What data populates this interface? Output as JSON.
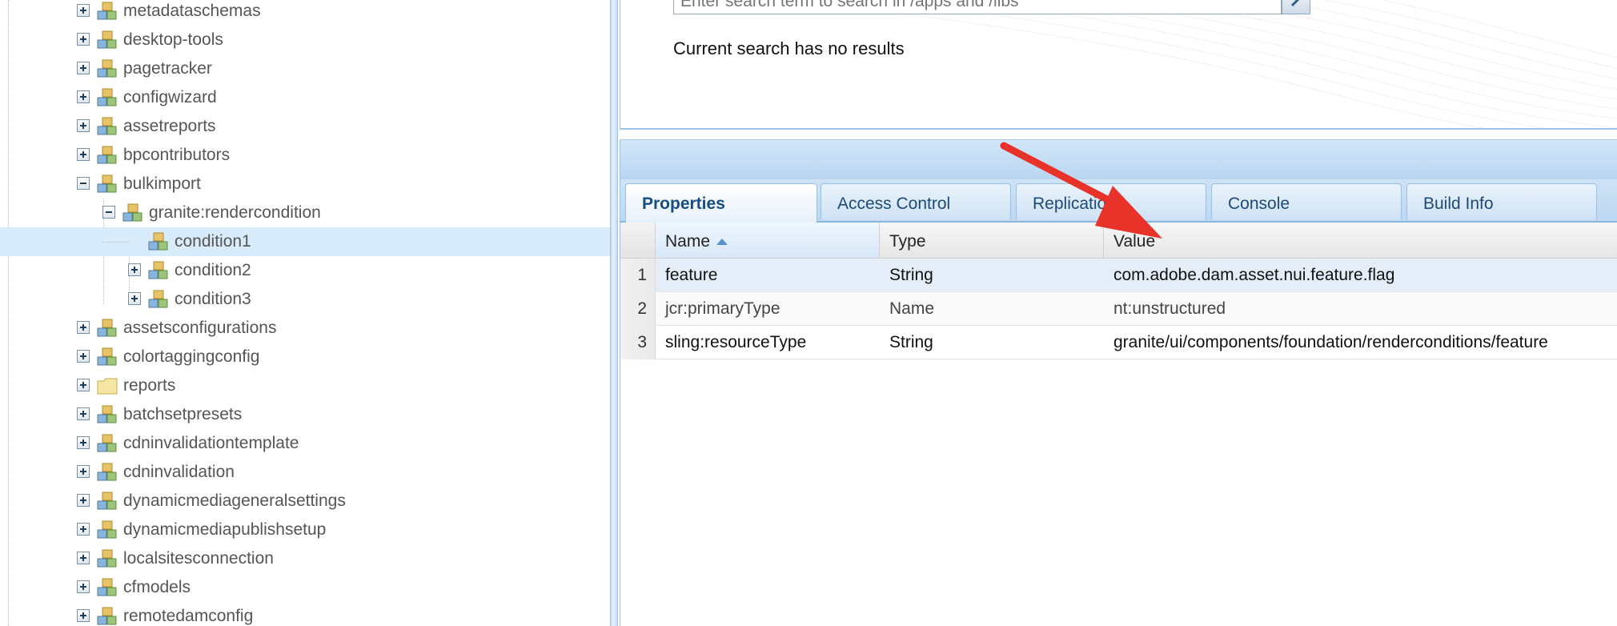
{
  "tree": {
    "items": [
      {
        "label": "metadataschemas",
        "toggle": "plus",
        "icon": "node-icon"
      },
      {
        "label": "desktop-tools",
        "toggle": "plus",
        "icon": "node-icon"
      },
      {
        "label": "pagetracker",
        "toggle": "plus",
        "icon": "node-icon"
      },
      {
        "label": "configwizard",
        "toggle": "plus",
        "icon": "node-icon"
      },
      {
        "label": "assetreports",
        "toggle": "plus",
        "icon": "node-icon"
      },
      {
        "label": "bpcontributors",
        "toggle": "plus",
        "icon": "node-icon"
      },
      {
        "label": "bulkimport",
        "toggle": "minus",
        "icon": "node-icon"
      },
      {
        "label": "granite:rendercondition",
        "toggle": "minus",
        "icon": "node-icon"
      },
      {
        "label": "condition1",
        "toggle": "none",
        "icon": "node-icon",
        "selected": true
      },
      {
        "label": "condition2",
        "toggle": "plus",
        "icon": "node-icon"
      },
      {
        "label": "condition3",
        "toggle": "plus",
        "icon": "node-icon"
      },
      {
        "label": "assetsconfigurations",
        "toggle": "plus",
        "icon": "node-icon"
      },
      {
        "label": "colortaggingconfig",
        "toggle": "plus",
        "icon": "node-icon"
      },
      {
        "label": "reports",
        "toggle": "plus",
        "icon": "folder-icon"
      },
      {
        "label": "batchsetpresets",
        "toggle": "plus",
        "icon": "node-icon"
      },
      {
        "label": "cdninvalidationtemplate",
        "toggle": "plus",
        "icon": "node-icon"
      },
      {
        "label": "cdninvalidation",
        "toggle": "plus",
        "icon": "node-icon"
      },
      {
        "label": "dynamicmediageneralsettings",
        "toggle": "plus",
        "icon": "node-icon"
      },
      {
        "label": "dynamicmediapublishsetup",
        "toggle": "plus",
        "icon": "node-icon"
      },
      {
        "label": "localsitesconnection",
        "toggle": "plus",
        "icon": "node-icon"
      },
      {
        "label": "cfmodels",
        "toggle": "plus",
        "icon": "node-icon"
      },
      {
        "label": "remotedamconfig",
        "toggle": "plus",
        "icon": "node-icon"
      }
    ]
  },
  "search": {
    "placeholder": "Enter search term to search in /apps and /libs",
    "status": "Current search has no results"
  },
  "tabs": [
    {
      "label": "Properties",
      "active": true
    },
    {
      "label": "Access Control"
    },
    {
      "label": "Replication"
    },
    {
      "label": "Console"
    },
    {
      "label": "Build Info"
    }
  ],
  "grid": {
    "columns": [
      "Name",
      "Type",
      "Value"
    ],
    "sorted_column": "Name",
    "rows": [
      {
        "num": "1",
        "name": "feature",
        "type": "String",
        "value": "com.adobe.dam.asset.nui.feature.flag"
      },
      {
        "num": "2",
        "name": "jcr:primaryType",
        "type": "Name",
        "value": "nt:unstructured"
      },
      {
        "num": "3",
        "name": "sling:resourceType",
        "type": "String",
        "value": "granite/ui/components/foundation/renderconditions/feature"
      }
    ]
  },
  "colors": {
    "accent": "#154d84",
    "selection": "#d9ecfb",
    "annotation": "#e8332a"
  }
}
